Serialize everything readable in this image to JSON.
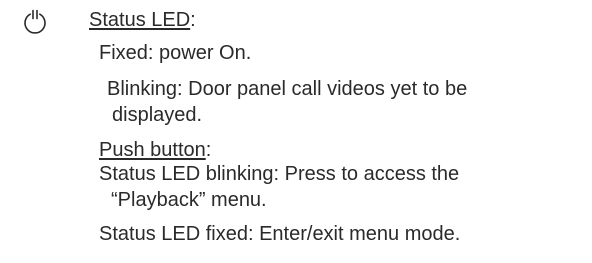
{
  "status_led": {
    "icon": "power-icon",
    "heading": "Status LED",
    "heading_suffix": ":",
    "fixed_text": "Fixed: power On.",
    "blinking_line1": "Blinking: Door panel call videos yet to be",
    "blinking_line2": "displayed."
  },
  "push_button": {
    "heading": "Push button",
    "heading_suffix": ":",
    "blinking_line1": "Status LED blinking: Press to access the",
    "blinking_line2": "“Playback” menu.",
    "fixed_text": "Status LED fixed: Enter/exit menu mode."
  }
}
